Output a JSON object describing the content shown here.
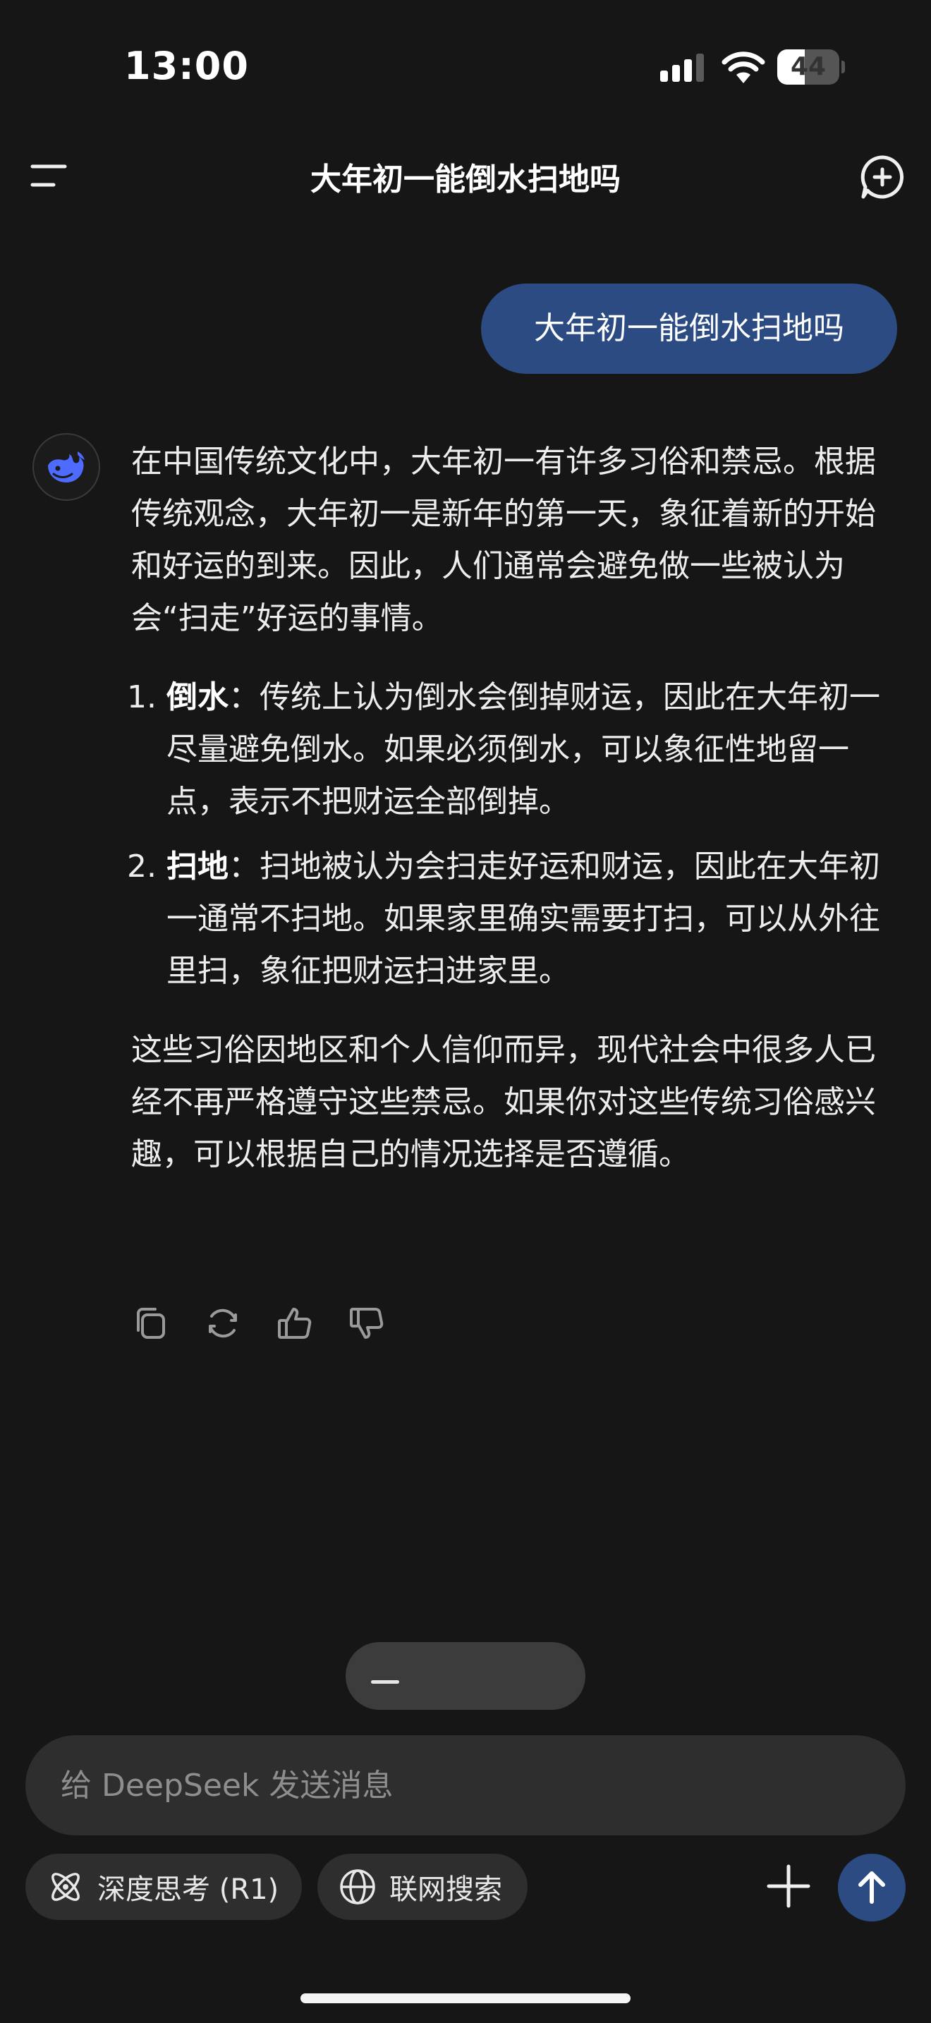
{
  "status_bar": {
    "time": "13:00",
    "battery": "44",
    "battery_level_percent": 44
  },
  "header": {
    "title": "大年初一能倒水扫地吗"
  },
  "user_message": "大年初一能倒水扫地吗",
  "assistant": {
    "intro": "在中国传统文化中，大年初一有许多习俗和禁忌。根据传统观念，大年初一是新年的第一天，象征着新的开始和好运的到来。因此，人们通常会避免做一些被认为会“扫走”好运的事情。",
    "items": [
      {
        "title": "倒水",
        "text": "：传统上认为倒水会倒掉财运，因此在大年初一尽量避免倒水。如果必须倒水，可以象征性地留一点，表示不把财运全部倒掉。"
      },
      {
        "title": "扫地",
        "text": "：扫地被认为会扫走好运和财运，因此在大年初一通常不扫地。如果家里确实需要打扫，可以从外往里扫，象征把财运扫进家里。"
      }
    ],
    "outro": "这些习俗因地区和个人信仰而异，现代社会中很多人已经不再严格遵守这些禁忌。如果你对这些传统习俗感兴趣，可以根据自己的情况选择是否遵循。"
  },
  "composer": {
    "placeholder": "给 DeepSeek 发送消息",
    "deep_think_label": "深度思考 (R1)",
    "web_search_label": "联网搜索"
  },
  "icons": {
    "menu": "menu-icon",
    "new_chat": "new-chat-icon",
    "avatar": "deepseek-whale-icon",
    "copy": "copy-icon",
    "regenerate": "refresh-icon",
    "like": "thumbs-up-icon",
    "dislike": "thumbs-down-icon",
    "deep_think": "atom-icon",
    "web_search": "globe-icon",
    "plus": "plus-icon",
    "send": "arrow-up-icon"
  },
  "colors": {
    "background": "#161616",
    "user_bubble": "#2b4b82",
    "send_button": "#2b4b82",
    "avatar_accent": "#4d6bfe"
  }
}
